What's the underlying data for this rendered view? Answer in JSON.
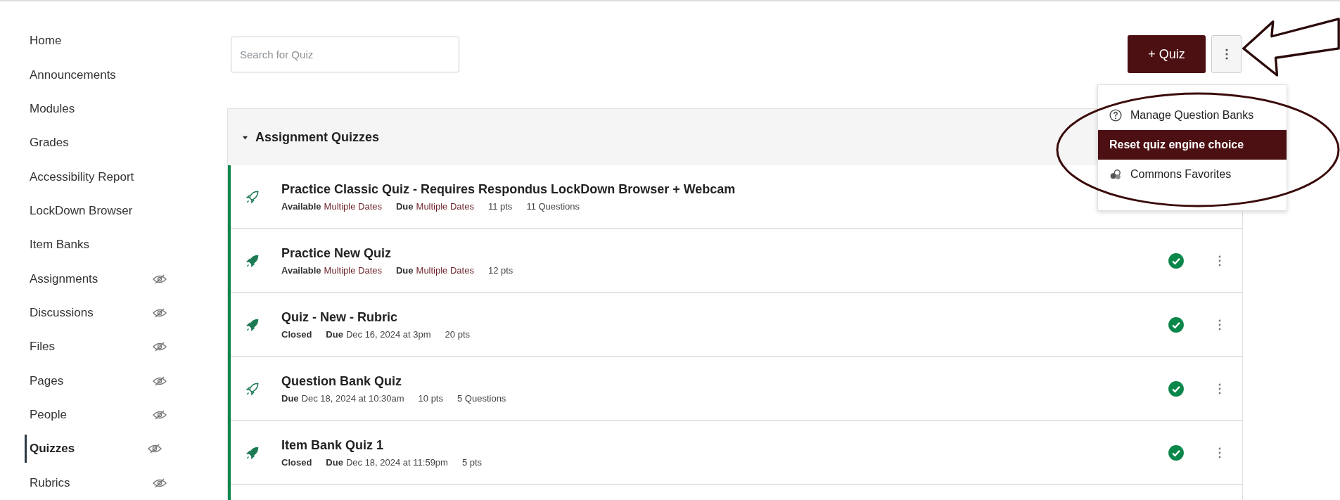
{
  "sidebar": {
    "items": [
      {
        "label": "Home",
        "hidden": false,
        "selected": false
      },
      {
        "label": "Announcements",
        "hidden": false,
        "selected": false
      },
      {
        "label": "Modules",
        "hidden": false,
        "selected": false
      },
      {
        "label": "Grades",
        "hidden": false,
        "selected": false
      },
      {
        "label": "Accessibility Report",
        "hidden": false,
        "selected": false
      },
      {
        "label": "LockDown Browser",
        "hidden": false,
        "selected": false
      },
      {
        "label": "Item Banks",
        "hidden": false,
        "selected": false
      },
      {
        "label": "Assignments",
        "hidden": true,
        "selected": false
      },
      {
        "label": "Discussions",
        "hidden": true,
        "selected": false
      },
      {
        "label": "Files",
        "hidden": true,
        "selected": false
      },
      {
        "label": "Pages",
        "hidden": true,
        "selected": false
      },
      {
        "label": "People",
        "hidden": true,
        "selected": false
      },
      {
        "label": "Quizzes",
        "hidden": true,
        "selected": true
      },
      {
        "label": "Rubrics",
        "hidden": true,
        "selected": false
      }
    ]
  },
  "search": {
    "placeholder": "Search for Quiz"
  },
  "add_button": {
    "icon": "+",
    "label": "Quiz"
  },
  "menu": {
    "items": [
      {
        "label": "Manage Question Banks",
        "kind": "question",
        "selected": false
      },
      {
        "label": "Reset quiz engine choice",
        "selected": true
      },
      {
        "label": "Commons Favorites",
        "kind": "commons",
        "selected": false
      }
    ]
  },
  "group": {
    "title": "Assignment Quizzes",
    "expanded": true,
    "quizzes": [
      {
        "kind": "classic",
        "title": "Practice Classic Quiz - Requires Respondus LockDown Browser + Webcam",
        "meta": [
          {
            "label": "Available",
            "value": "Multiple Dates",
            "link": true
          },
          {
            "label": "Due",
            "value": "Multiple Dates",
            "link": true
          },
          {
            "value": "11 pts",
            "link": false
          },
          {
            "value": "11 Questions",
            "link": false
          }
        ]
      },
      {
        "kind": "new",
        "title": "Practice New Quiz",
        "published": true,
        "meta": [
          {
            "label": "Available",
            "value": "Multiple Dates",
            "link": true
          },
          {
            "label": "Due",
            "value": "Multiple Dates",
            "link": true
          },
          {
            "value": "12 pts",
            "link": false
          }
        ]
      },
      {
        "kind": "new",
        "title": "Quiz - New - Rubric",
        "published": true,
        "meta": [
          {
            "label": "Closed"
          },
          {
            "label": "Due",
            "value": "Dec 16, 2024 at 3pm",
            "link": false
          },
          {
            "value": "20 pts",
            "link": false
          }
        ]
      },
      {
        "kind": "classic",
        "title": "Question Bank Quiz",
        "published": true,
        "meta": [
          {
            "label": "Due",
            "value": "Dec 18, 2024 at 10:30am",
            "link": false
          },
          {
            "value": "10 pts",
            "link": false
          },
          {
            "value": "5 Questions",
            "link": false
          }
        ]
      },
      {
        "kind": "new",
        "title": "Item Bank Quiz 1",
        "published": true,
        "meta": [
          {
            "label": "Closed"
          },
          {
            "label": "Due",
            "value": "Dec 18, 2024 at 11:59pm",
            "link": false
          },
          {
            "value": "5 pts",
            "link": false
          }
        ]
      }
    ]
  }
}
